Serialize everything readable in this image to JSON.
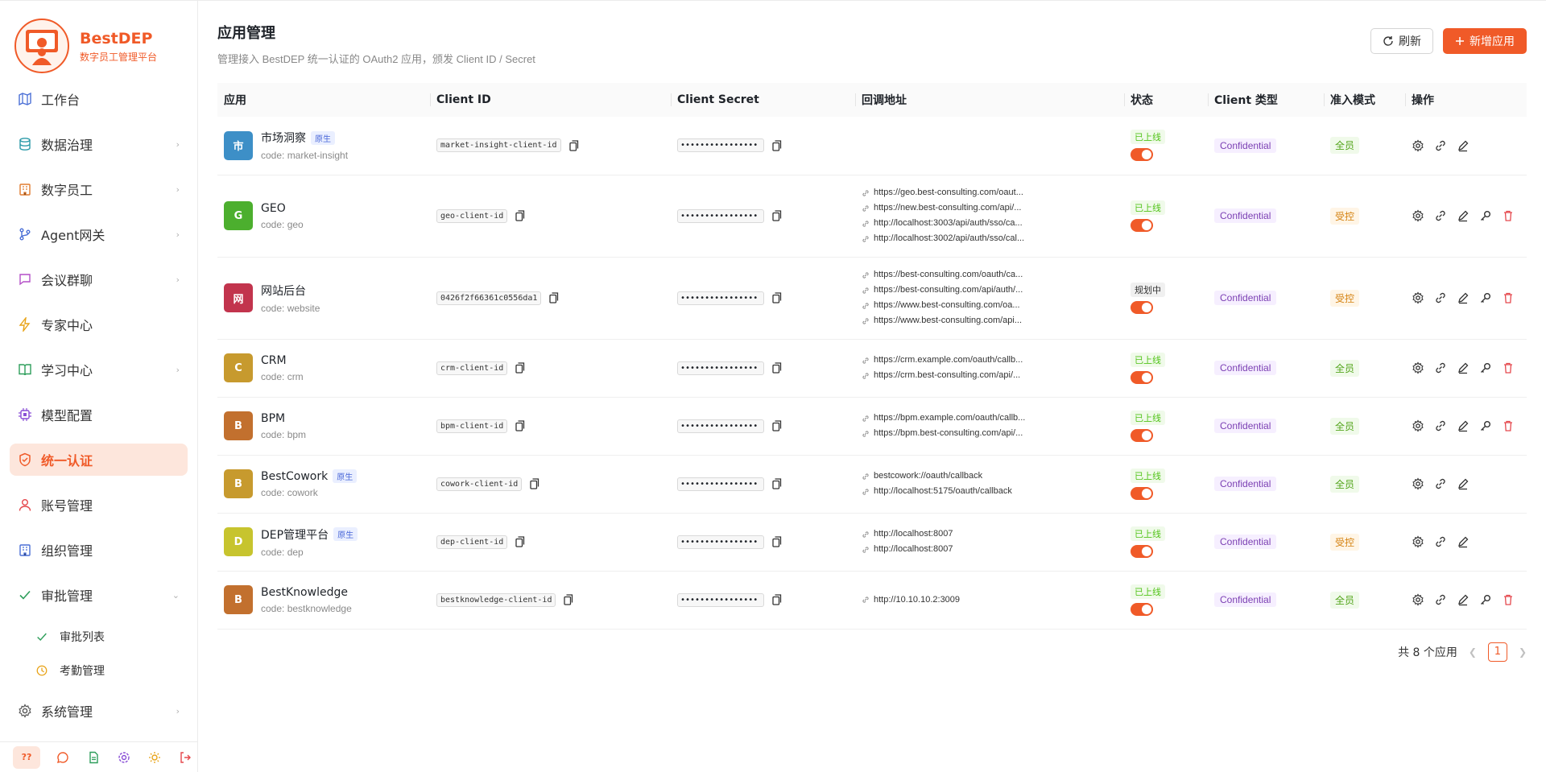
{
  "brand": {
    "name": "BestDEP",
    "subtitle": "数字员工管理平台"
  },
  "sidebar": {
    "items": [
      {
        "label": "工作台",
        "icon": "map-icon",
        "chevron": false
      },
      {
        "label": "数据治理",
        "icon": "database-icon",
        "chevron": true
      },
      {
        "label": "数字员工",
        "icon": "building-icon",
        "chevron": true
      },
      {
        "label": "Agent网关",
        "icon": "git-branch-icon",
        "chevron": true
      },
      {
        "label": "会议群聊",
        "icon": "chat-icon",
        "chevron": true
      },
      {
        "label": "专家中心",
        "icon": "lightning-icon",
        "chevron": false
      },
      {
        "label": "学习中心",
        "icon": "book-icon",
        "chevron": true
      },
      {
        "label": "模型配置",
        "icon": "chip-icon",
        "chevron": false
      },
      {
        "label": "统一认证",
        "icon": "shield-icon",
        "chevron": false,
        "active": true
      },
      {
        "label": "账号管理",
        "icon": "user-icon",
        "chevron": false
      },
      {
        "label": "组织管理",
        "icon": "org-icon",
        "chevron": false
      },
      {
        "label": "审批管理",
        "icon": "check-icon",
        "chevron": true,
        "expanded": true
      }
    ],
    "sub_items": [
      {
        "label": "审批列表",
        "icon": "check-icon"
      },
      {
        "label": "考勤管理",
        "icon": "clock-icon"
      }
    ],
    "system": {
      "label": "系统管理",
      "icon": "gear-icon"
    },
    "footer_q": "??"
  },
  "header": {
    "title": "应用管理",
    "subtitle": "管理接入 BestDEP 统一认证的 OAuth2 应用，颁发 Client ID / Secret",
    "refresh_label": "刷新",
    "add_label": "新增应用"
  },
  "table": {
    "columns": [
      "应用",
      "Client ID",
      "Client Secret",
      "回调地址",
      "状态",
      "Client 类型",
      "准入模式",
      "操作"
    ],
    "rows": [
      {
        "initial": "市",
        "color": "#3d8fc7",
        "name": "市场洞察",
        "native": true,
        "code": "code: market-insight",
        "client_id": "market-insight-client-id",
        "secret": "••••••••••••••••",
        "urls": [],
        "status": "已上线",
        "status_kind": "online",
        "type": "Confidential",
        "mode": "全员",
        "mode_kind": "all",
        "ops": [
          "gear",
          "link",
          "edit"
        ]
      },
      {
        "initial": "G",
        "color": "#4caf2e",
        "name": "GEO",
        "native": false,
        "code": "code: geo",
        "client_id": "geo-client-id",
        "secret": "••••••••••••••••",
        "urls": [
          "https://geo.best-consulting.com/oaut...",
          "https://new.best-consulting.com/api/...",
          "http://localhost:3003/api/auth/sso/ca...",
          "http://localhost:3002/api/auth/sso/cal..."
        ],
        "status": "已上线",
        "status_kind": "online",
        "type": "Confidential",
        "mode": "受控",
        "mode_kind": "ctrl",
        "ops": [
          "gear",
          "link",
          "edit",
          "key",
          "delete"
        ]
      },
      {
        "initial": "网",
        "color": "#c2344d",
        "name": "网站后台",
        "native": false,
        "code": "code: website",
        "client_id": "0426f2f66361c0556da1",
        "secret": "••••••••••••••••",
        "urls": [
          "https://best-consulting.com/oauth/ca...",
          "https://best-consulting.com/api/auth/...",
          "https://www.best-consulting.com/oa...",
          "https://www.best-consulting.com/api..."
        ],
        "status": "规划中",
        "status_kind": "plan",
        "type": "Confidential",
        "mode": "受控",
        "mode_kind": "ctrl",
        "ops": [
          "gear",
          "link",
          "edit",
          "key",
          "delete"
        ]
      },
      {
        "initial": "C",
        "color": "#c79a2e",
        "name": "CRM",
        "native": false,
        "code": "code: crm",
        "client_id": "crm-client-id",
        "secret": "••••••••••••••••",
        "urls": [
          "https://crm.example.com/oauth/callb...",
          "https://crm.best-consulting.com/api/..."
        ],
        "status": "已上线",
        "status_kind": "online",
        "type": "Confidential",
        "mode": "全员",
        "mode_kind": "all",
        "ops": [
          "gear",
          "link",
          "edit",
          "key",
          "delete"
        ]
      },
      {
        "initial": "B",
        "color": "#c2702e",
        "name": "BPM",
        "native": false,
        "code": "code: bpm",
        "client_id": "bpm-client-id",
        "secret": "••••••••••••••••",
        "urls": [
          "https://bpm.example.com/oauth/callb...",
          "https://bpm.best-consulting.com/api/..."
        ],
        "status": "已上线",
        "status_kind": "online",
        "type": "Confidential",
        "mode": "全员",
        "mode_kind": "all",
        "ops": [
          "gear",
          "link",
          "edit",
          "key",
          "delete"
        ]
      },
      {
        "initial": "B",
        "color": "#c79a2e",
        "name": "BestCowork",
        "native": true,
        "code": "code: cowork",
        "client_id": "cowork-client-id",
        "secret": "••••••••••••••••",
        "urls": [
          "bestcowork://oauth/callback",
          "http://localhost:5175/oauth/callback"
        ],
        "status": "已上线",
        "status_kind": "online",
        "type": "Confidential",
        "mode": "全员",
        "mode_kind": "all",
        "ops": [
          "gear",
          "link",
          "edit"
        ]
      },
      {
        "initial": "D",
        "color": "#c7c42e",
        "name": "DEP管理平台",
        "native": true,
        "code": "code: dep",
        "client_id": "dep-client-id",
        "secret": "••••••••••••••••",
        "urls": [
          "http://localhost:8007",
          "http://localhost:8007"
        ],
        "status": "已上线",
        "status_kind": "online",
        "type": "Confidential",
        "mode": "受控",
        "mode_kind": "ctrl",
        "ops": [
          "gear",
          "link",
          "edit"
        ]
      },
      {
        "initial": "B",
        "color": "#c2702e",
        "name": "BestKnowledge",
        "native": false,
        "code": "code: bestknowledge",
        "client_id": "bestknowledge-client-id",
        "secret": "••••••••••••••••",
        "urls": [
          "http://10.10.10.2:3009"
        ],
        "status": "已上线",
        "status_kind": "online",
        "type": "Confidential",
        "mode": "全员",
        "mode_kind": "all",
        "ops": [
          "gear",
          "link",
          "edit",
          "key",
          "delete"
        ]
      }
    ],
    "native_label": "原生"
  },
  "pager": {
    "total_label": "共 8 个应用",
    "current_page": "1"
  },
  "colors": {
    "accent": "#f05a28",
    "online": "#52c41a",
    "warning": "#d4810f",
    "danger": "#e5484d"
  }
}
